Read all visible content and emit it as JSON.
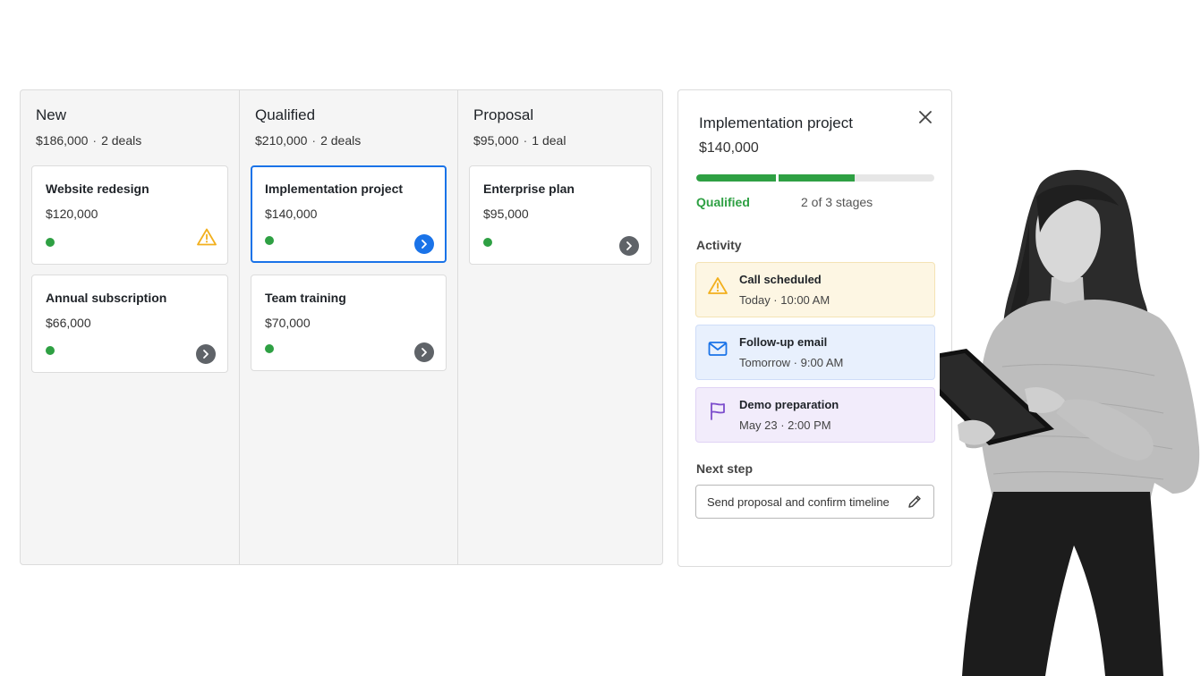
{
  "board": {
    "columns": [
      {
        "title": "New",
        "total": "$186,000",
        "count": "2 deals",
        "cards": [
          {
            "title": "Website redesign",
            "value": "$120,000",
            "status": "green",
            "indicator": "warning-icon"
          },
          {
            "title": "Annual subscription",
            "value": "$66,000",
            "status": "green",
            "indicator": "chevron-right-icon"
          }
        ]
      },
      {
        "title": "Qualified",
        "total": "$210,000",
        "count": "2 deals",
        "cards": [
          {
            "title": "Implementation project",
            "value": "$140,000",
            "status": "green",
            "indicator": "chevron-right-icon",
            "selected": true
          },
          {
            "title": "Team training",
            "value": "$70,000",
            "status": "green",
            "indicator": "chevron-right-icon"
          }
        ]
      },
      {
        "title": "Proposal",
        "total": "$95,000",
        "count": "1 deal",
        "cards": [
          {
            "title": "Enterprise plan",
            "value": "$95,000",
            "status": "green",
            "indicator": "chevron-right-icon"
          }
        ]
      }
    ],
    "separator": "·"
  },
  "detail": {
    "title": "Implementation project",
    "value": "$140,000",
    "progress": {
      "completed_stages": 2,
      "total_stages": 3,
      "fraction": 0.667
    },
    "stage_label": "Qualified",
    "stage_count": "2 of 3 stages",
    "activity_heading": "Activity",
    "activities": [
      {
        "title": "Call scheduled",
        "time": "Today · 10:00 AM",
        "icon": "warning-icon"
      },
      {
        "title": "Follow-up email",
        "time": "Tomorrow · 9:00 AM",
        "icon": "mail-icon"
      },
      {
        "title": "Demo preparation",
        "time": "May 23 · 2:00 PM",
        "icon": "flag-icon"
      }
    ],
    "next_step_heading": "Next step",
    "next_step_text": "Send proposal and confirm timeline"
  },
  "colors": {
    "accent": "#1a73e8",
    "success": "#2ea043",
    "warning": "#f2b01e",
    "mail": "#1a73e8",
    "flag": "#7c4dcc",
    "neutral_icon": "#5f6368"
  }
}
